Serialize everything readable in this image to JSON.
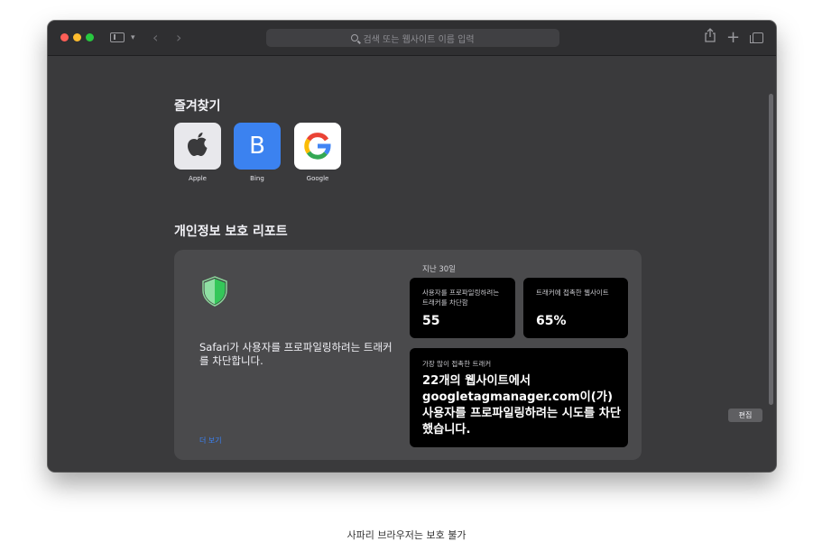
{
  "window": {
    "address_placeholder": "검색 또는 웹사이트 이름 입력"
  },
  "favorites": {
    "title": "즐겨찾기",
    "items": [
      {
        "label": "Apple"
      },
      {
        "label": "Bing",
        "glyph": "B"
      },
      {
        "label": "Google"
      }
    ]
  },
  "privacy_report": {
    "title": "개인정보 보호 리포트",
    "description": "Safari가 사용자를 프로파일링하려는 트래커를 차단합니다.",
    "more_link": "더 보기",
    "period": "지난 30일",
    "trackers_blocked_label": "사용자를 프로파일링하려는 트래커를 차단함",
    "trackers_blocked_value": "55",
    "sites_contacted_label": "트래커에 접촉한 웹사이트",
    "sites_contacted_value": "65%",
    "top_tracker_label": "가장 많이 접촉한 트래커",
    "top_tracker_text": "22개의 웹사이트에서 googletagmanager.com이(가) 사용자를 프로파일링하려는 시도를 차단했습니다."
  },
  "edit_button": "편집",
  "caption": "사파리 브라우저는 보호 불가",
  "icons": {
    "apple": "apple-logo",
    "google": "google-logo",
    "shield": "shield-icon"
  },
  "colors": {
    "window_bg": "#3a3a3c",
    "card_bg": "#4a4a4c",
    "link": "#3a82f7",
    "shield_green": "#34c759"
  }
}
